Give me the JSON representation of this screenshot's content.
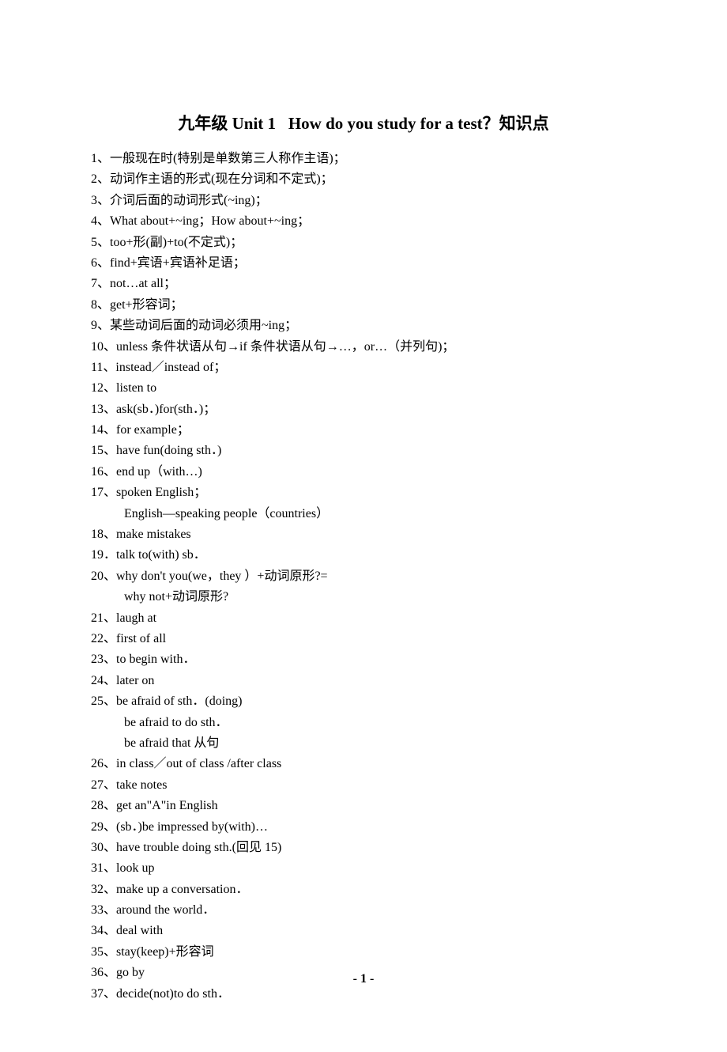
{
  "title": {
    "prefix": "九年级",
    "unit": "Unit 1",
    "eng": "How do you study for a test？",
    "suffix": "知识点"
  },
  "items": [
    "1、一般现在时(特别是单数第三人称作主语)；",
    "2、动词作主语的形式(现在分词和不定式)；",
    "3、介词后面的动词形式(~ing)；",
    "4、What about+~ing；How about+~ing；",
    "5、too+形(副)+to(不定式)；",
    "6、find+宾语+宾语补足语；",
    "7、not…at all；",
    "8、get+形容词；",
    "9、某些动词后面的动词必须用~ing；",
    "10、unless 条件状语从句→if 条件状语从句→…，or…（并列句)；",
    "11、instead／instead of；",
    "12、listen to",
    "13、ask(sb．)for(sth．)；",
    "14、for example；",
    "15、have fun(doing sth．)",
    "16、end up（with…)",
    "17、spoken English；",
    "",
    "18、make mistakes",
    "19．talk to(with) sb．",
    "20、why don't you(we，they ）+动词原形?=",
    "",
    "21、laugh at",
    "22、first of all",
    "23、to begin with．",
    "24、later on",
    "25、be afraid of sth．(doing)",
    "",
    "",
    "26、in class／out of class /after class",
    "27、take notes",
    "28、get an\"A\"in English",
    "29、(sb．)be impressed by(with)…",
    "30、have trouble doing sth.(回见 15)",
    "31、look up",
    "32、make up a conversation．",
    "33、around the world．",
    "34、deal with",
    "35、stay(keep)+形容词",
    "36、go by",
    "37、decide(not)to do sth．"
  ],
  "subs": {
    "17": "English—speaking people（countries）",
    "21": "why not+动词原形?",
    "27": "be afraid to do sth．",
    "28": "be afraid that 从句"
  },
  "pagenum": "- 1 -"
}
